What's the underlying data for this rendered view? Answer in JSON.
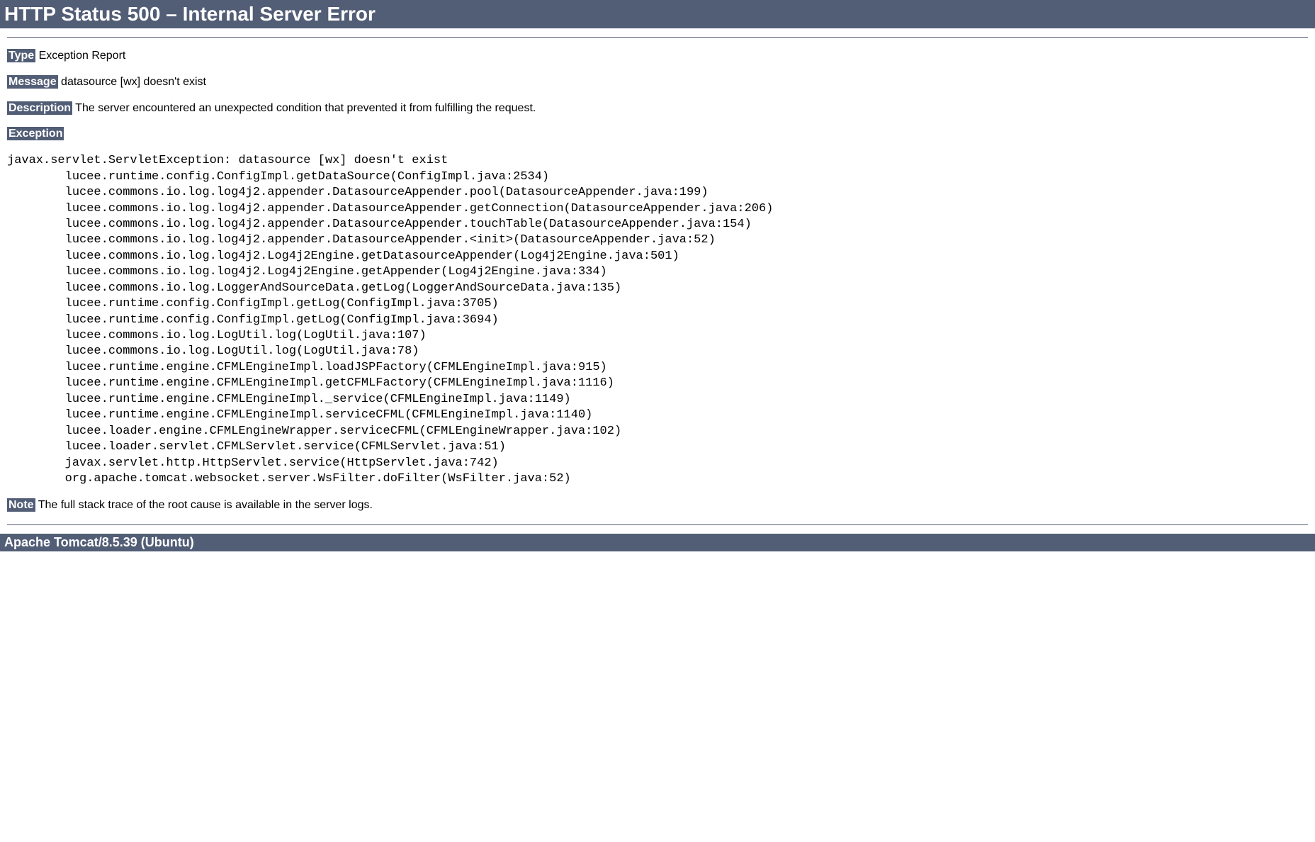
{
  "title": "HTTP Status 500 – Internal Server Error",
  "labels": {
    "type": "Type",
    "message": "Message",
    "description": "Description",
    "exception": "Exception",
    "note": "Note"
  },
  "values": {
    "type": " Exception Report",
    "message": " datasource [wx] doesn't exist",
    "description": " The server encountered an unexpected condition that prevented it from fulfilling the request.",
    "note": " The full stack trace of the root cause is available in the server logs."
  },
  "exception_trace": "javax.servlet.ServletException: datasource [wx] doesn't exist\n\tlucee.runtime.config.ConfigImpl.getDataSource(ConfigImpl.java:2534)\n\tlucee.commons.io.log.log4j2.appender.DatasourceAppender.pool(DatasourceAppender.java:199)\n\tlucee.commons.io.log.log4j2.appender.DatasourceAppender.getConnection(DatasourceAppender.java:206)\n\tlucee.commons.io.log.log4j2.appender.DatasourceAppender.touchTable(DatasourceAppender.java:154)\n\tlucee.commons.io.log.log4j2.appender.DatasourceAppender.<init>(DatasourceAppender.java:52)\n\tlucee.commons.io.log.log4j2.Log4j2Engine.getDatasourceAppender(Log4j2Engine.java:501)\n\tlucee.commons.io.log.log4j2.Log4j2Engine.getAppender(Log4j2Engine.java:334)\n\tlucee.commons.io.log.LoggerAndSourceData.getLog(LoggerAndSourceData.java:135)\n\tlucee.runtime.config.ConfigImpl.getLog(ConfigImpl.java:3705)\n\tlucee.runtime.config.ConfigImpl.getLog(ConfigImpl.java:3694)\n\tlucee.commons.io.log.LogUtil.log(LogUtil.java:107)\n\tlucee.commons.io.log.LogUtil.log(LogUtil.java:78)\n\tlucee.runtime.engine.CFMLEngineImpl.loadJSPFactory(CFMLEngineImpl.java:915)\n\tlucee.runtime.engine.CFMLEngineImpl.getCFMLFactory(CFMLEngineImpl.java:1116)\n\tlucee.runtime.engine.CFMLEngineImpl._service(CFMLEngineImpl.java:1149)\n\tlucee.runtime.engine.CFMLEngineImpl.serviceCFML(CFMLEngineImpl.java:1140)\n\tlucee.loader.engine.CFMLEngineWrapper.serviceCFML(CFMLEngineWrapper.java:102)\n\tlucee.loader.servlet.CFMLServlet.service(CFMLServlet.java:51)\n\tjavax.servlet.http.HttpServlet.service(HttpServlet.java:742)\n\torg.apache.tomcat.websocket.server.WsFilter.doFilter(WsFilter.java:52)",
  "footer": "Apache Tomcat/8.5.39 (Ubuntu)"
}
